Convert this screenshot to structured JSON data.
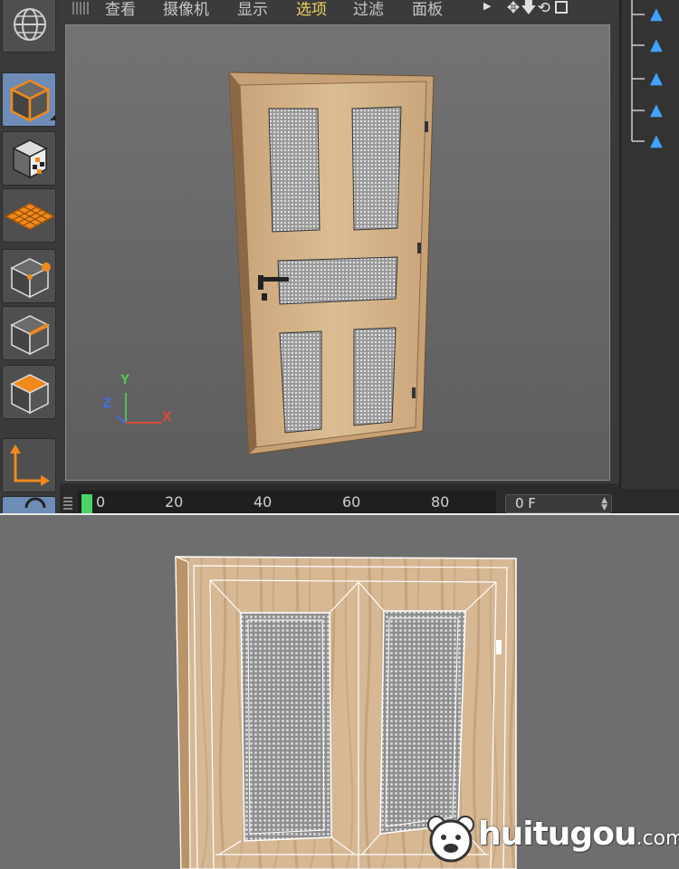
{
  "menu": {
    "items": [
      {
        "label": "查看"
      },
      {
        "label": "摄像机"
      },
      {
        "label": "显示"
      },
      {
        "label": "选项"
      },
      {
        "label": "过滤"
      },
      {
        "label": "面板"
      }
    ],
    "active_index": 3,
    "icons": [
      "triangle-right-icon",
      "move-arrows-icon",
      "arrow-down-icon",
      "rotate-icon",
      "fullscreen-icon"
    ]
  },
  "toolbar": {
    "tools": [
      {
        "name": "globe-tool",
        "icon": "globe-icon"
      },
      {
        "name": "cube-tool",
        "icon": "cube-icon",
        "active": true
      },
      {
        "name": "texture-tool",
        "icon": "checker-cube-icon"
      },
      {
        "name": "workplane-tool",
        "icon": "grid-plane-icon"
      },
      {
        "name": "points-mode",
        "icon": "point-cube-icon"
      },
      {
        "name": "edges-mode",
        "icon": "edge-cube-icon"
      },
      {
        "name": "polygons-mode",
        "icon": "polygon-cube-icon"
      },
      {
        "name": "axis-tool",
        "icon": "axis-icon"
      }
    ]
  },
  "viewport": {
    "axis_y": "Y",
    "axis_x": "X",
    "axis_z": "Z",
    "colors": {
      "y": "#4ec05a",
      "x": "#d84a3a",
      "z": "#4a6cd8"
    }
  },
  "objects": {
    "rows": [
      {
        "icon": "triangle-mesh-icon"
      },
      {
        "icon": "triangle-mesh-icon"
      },
      {
        "icon": "triangle-mesh-icon"
      },
      {
        "icon": "triangle-mesh-icon"
      },
      {
        "icon": "triangle-mesh-icon"
      }
    ]
  },
  "timeline": {
    "ticks": [
      "0",
      "20",
      "40",
      "60",
      "80"
    ],
    "current_frame": "0 F"
  },
  "watermark": {
    "text": "huitugou",
    "suffix": ".com",
    "logo": "bear-face-icon"
  },
  "colors": {
    "accent_active": "#f0d060",
    "wood": "#d2b48c",
    "tool_orange": "#f08a1c",
    "object_blue": "#3fa3ff"
  }
}
